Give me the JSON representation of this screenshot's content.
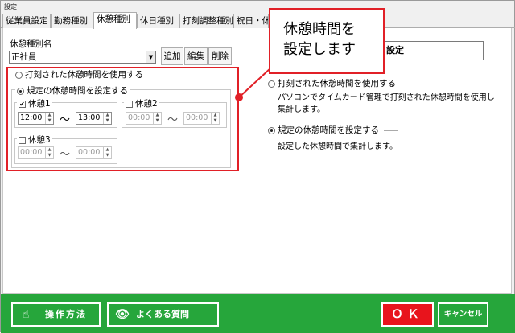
{
  "window": {
    "title": "設定"
  },
  "tabs": [
    {
      "label": "従業員設定"
    },
    {
      "label": "勤務種別"
    },
    {
      "label": "休憩種別"
    },
    {
      "label": "休日種別"
    },
    {
      "label": "打刻調整種別"
    },
    {
      "label": "祝日・休"
    }
  ],
  "left": {
    "name_label": "休憩種別名",
    "combo_value": "正社員",
    "add_label": "追加",
    "edit_label": "編集",
    "delete_label": "削除",
    "radio_use_recorded": "打刻された休憩時間を使用する",
    "radio_use_preset": "規定の休憩時間を設定する",
    "break1": {
      "label": "休憩1",
      "start": "12:00",
      "end": "13:00"
    },
    "break2": {
      "label": "休憩2",
      "start": "00:00",
      "end": "00:00"
    },
    "break3": {
      "label": "休憩3",
      "start": "00:00",
      "end": "00:00"
    },
    "tilde": "～"
  },
  "right": {
    "box_label": "設定",
    "radio_use_recorded": "打刻された休憩時間を使用する",
    "desc_recorded_line1": "パソコンでタイムカード管理で打刻された休憩時間を使用し",
    "desc_recorded_line2": "集計します。",
    "radio_use_preset": "規定の休憩時間を設定する",
    "desc_preset": "設定した休憩時間で集計します。"
  },
  "callout": {
    "text": "休憩時間を\n設定します"
  },
  "footer": {
    "howto_label": "操作方法",
    "faq_label": "よくある質問",
    "ok_label": "ＯＫ",
    "cancel_label": "キャンセル"
  },
  "colors": {
    "accent_red": "#e12027",
    "footer_green": "#26a63b",
    "ok_red": "#e8141c"
  },
  "icons": [
    "hand-pointer-icon",
    "eye-icon",
    "combo-arrow-icon"
  ]
}
